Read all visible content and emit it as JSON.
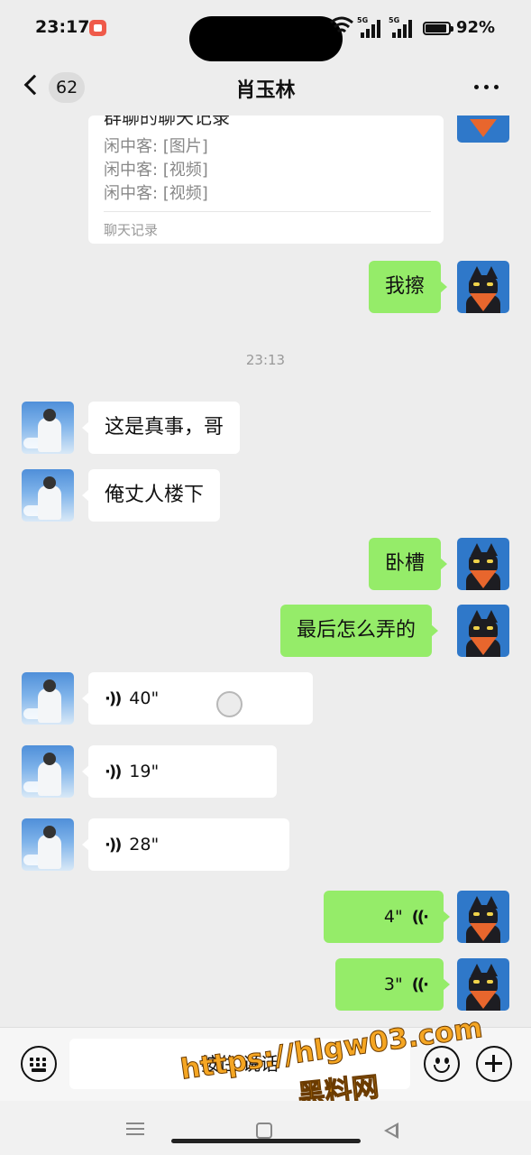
{
  "status_bar": {
    "time": "23:17",
    "network_tag_1": "5G",
    "network_tag_2": "5G",
    "battery": "92%"
  },
  "header": {
    "unread_count": "62",
    "title": "肖玉林"
  },
  "forwarded_card": {
    "title_partial": "群聊的聊天记录",
    "lines": [
      "闲中客: [图片]",
      "闲中客: [视频]",
      "闲中客: [视频]"
    ],
    "footer": "聊天记录"
  },
  "messages": {
    "m1": {
      "text": "我擦"
    },
    "timestamp": "23:13",
    "m2": {
      "text": "这是真事，哥"
    },
    "m3": {
      "text": "俺丈人楼下"
    },
    "m4": {
      "text": "卧槽"
    },
    "m5": {
      "text": "最后怎么弄的"
    },
    "v1": {
      "duration": "40\""
    },
    "v2": {
      "duration": "19\""
    },
    "v3": {
      "duration": "28\""
    },
    "v4": {
      "duration": "4\""
    },
    "v5": {
      "duration": "3\""
    }
  },
  "input_bar": {
    "hold_to_talk": "按住 说话"
  },
  "watermark": {
    "url": "https://hlgw03.com",
    "name": "黑料网"
  },
  "colors": {
    "background": "#ededed",
    "outgoing_bubble": "#95ec69",
    "incoming_bubble": "#ffffff",
    "watermark": "#f5a623"
  }
}
